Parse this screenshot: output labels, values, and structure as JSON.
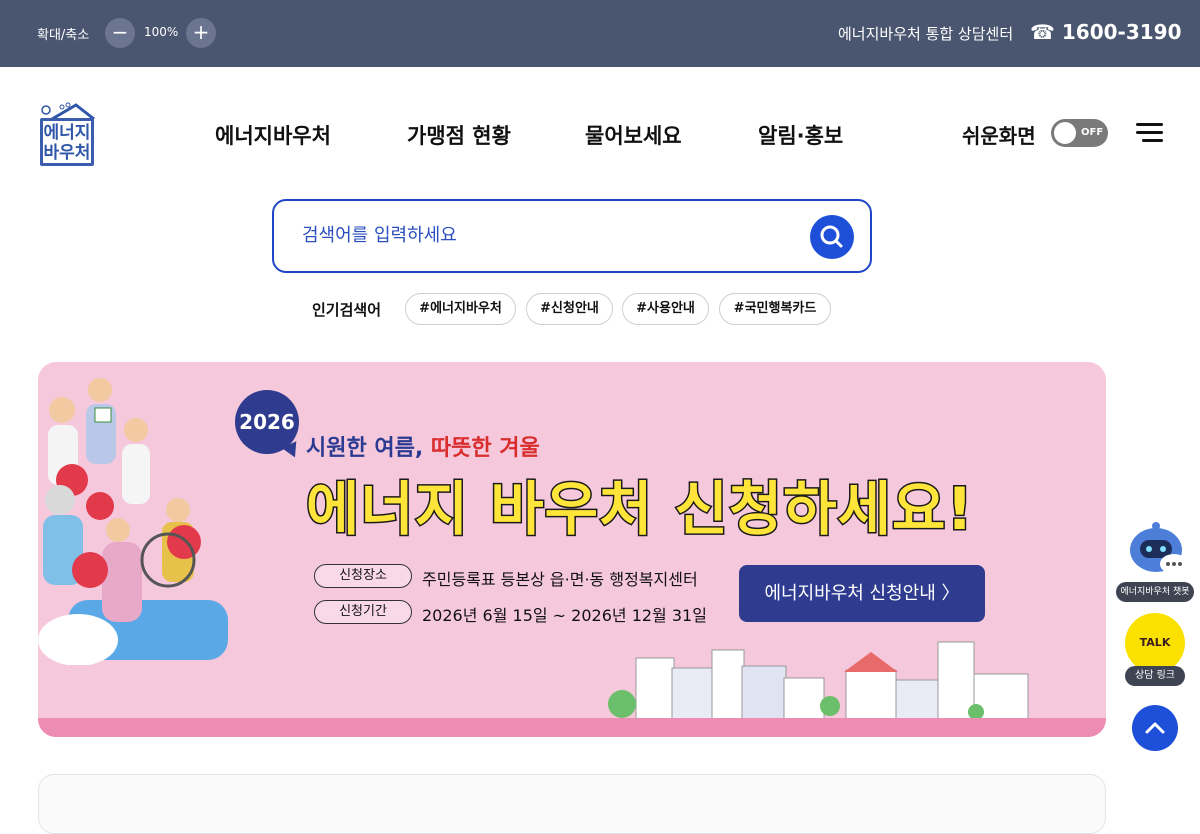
{
  "topbar": {
    "zoom_label": "확대/축소",
    "zoom_minus": "−",
    "zoom_value": "100%",
    "zoom_plus": "+",
    "center_label": "에너지바우처 통합 상담센터",
    "phone": "☎ 1600-3190"
  },
  "header": {
    "logo_text": "에너지\n바우처",
    "nav": [
      "에너지바우처",
      "가맹점 현황",
      "물어보세요",
      "알림·홍보"
    ],
    "easy_label": "쉬운화면",
    "toggle_text": "OFF"
  },
  "search": {
    "placeholder": "검색어를 입력하세요",
    "popular_label": "인기검색어",
    "tags": [
      "#에너지바우처",
      "#신청안내",
      "#사용안내",
      "#국민행복카드"
    ]
  },
  "banner": {
    "year": "2026",
    "slogan_blue": "시원한 여름, ",
    "slogan_red": "따뜻한 겨울",
    "headline": "에너지 바우처 신청하세요!",
    "place_label": "신청장소",
    "place_value": "주민등록표 등본상 읍·면·동 행정복지센터",
    "period_label": "신청기간",
    "period_value": "2026년 6월 15일 ~ 2026년 12월 31일",
    "guide_button": "에너지바우처 신청안내 〉"
  },
  "side": {
    "chatbot_label": "에너지바우처 챗봇",
    "talk_text": "TALK",
    "talk_label": "상담 링크"
  },
  "colors": {
    "topbar": "#4a5570",
    "brand_blue": "#1e4fd8",
    "banner_bg": "#f6c8dc",
    "headline_yellow": "#ffe43a",
    "navy": "#2e3b8f"
  }
}
